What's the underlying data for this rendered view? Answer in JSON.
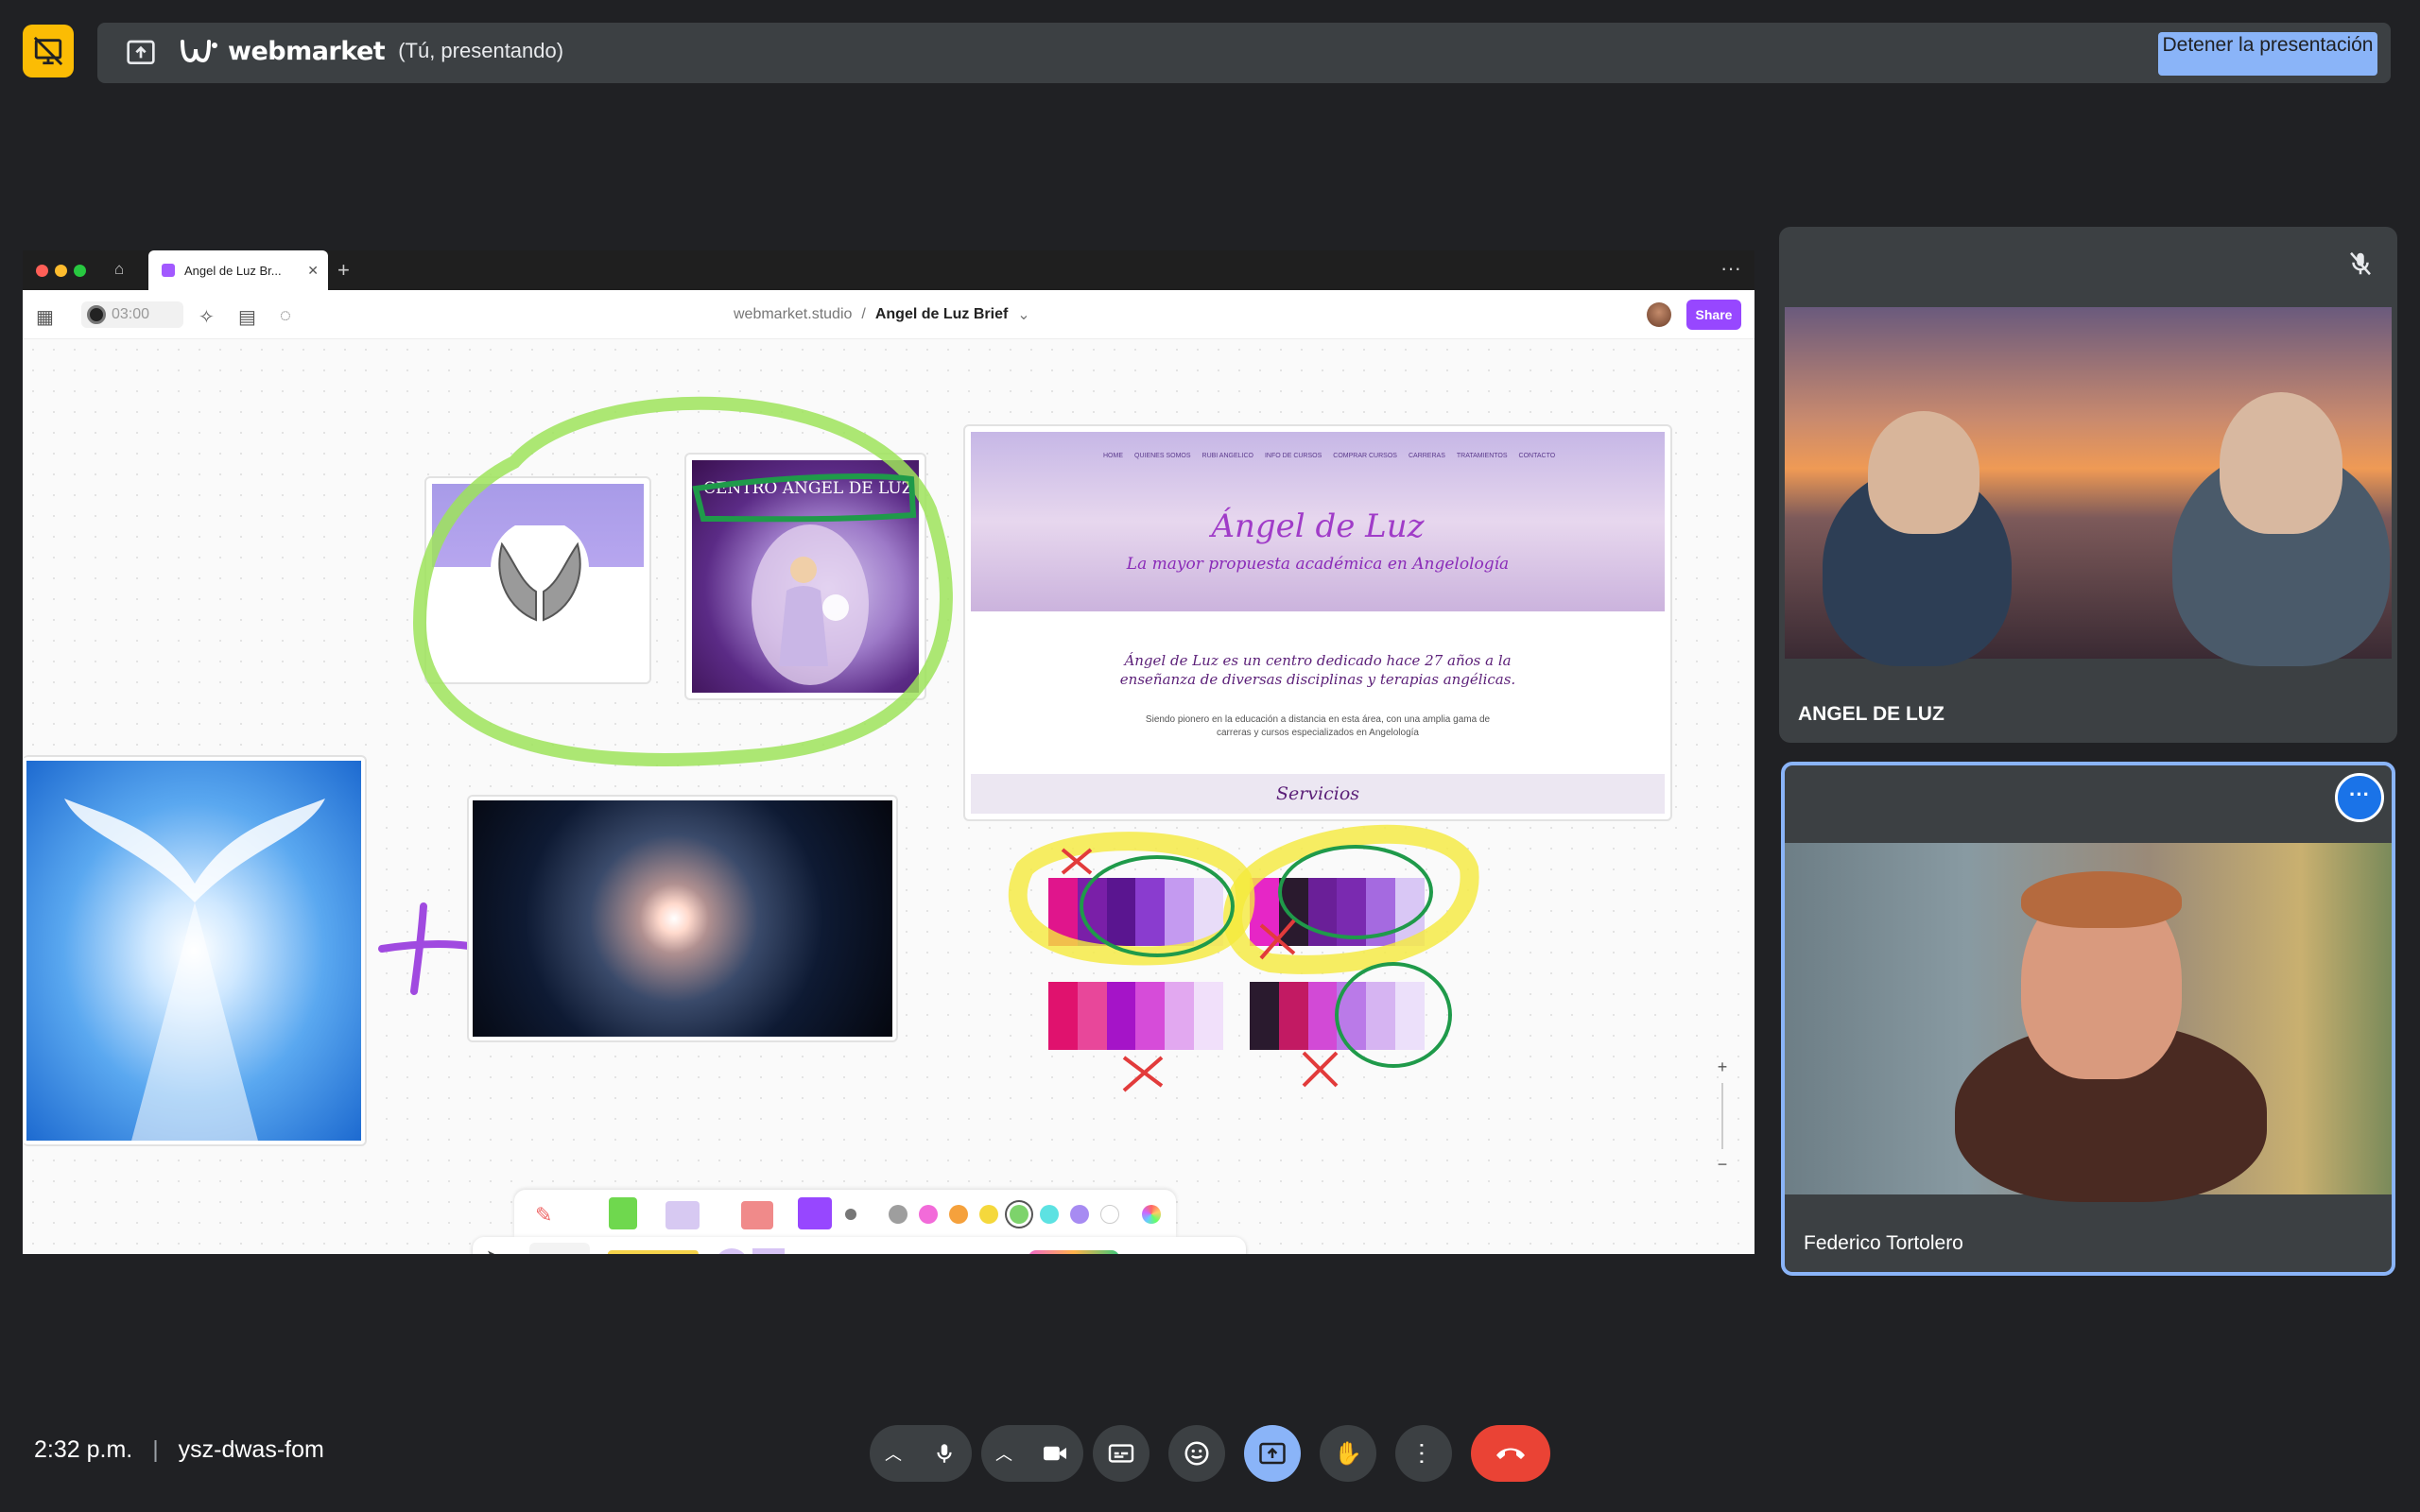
{
  "presenting_bar": {
    "brand": "webmarket",
    "status": "(Tú, presentando)",
    "stop_button": "Detener la presentación",
    "colors": {
      "badge": "#fbbc04",
      "stop_button": "#8ab4f8"
    }
  },
  "shared_screen": {
    "tab_title": "Angel de Luz Br...",
    "timer": "03:00",
    "breadcrumb": {
      "workspace": "webmarket.studio",
      "file": "Angel de Luz Brief"
    },
    "share_button": "Share",
    "cards": {
      "angel_title": "CENTRO ÁNGEL DE LUZ",
      "web": {
        "nav": [
          "HOME",
          "QUIENES SOMOS",
          "RUBI ANGELICO",
          "INFO DE CURSOS",
          "COMPRAR CURSOS",
          "CARRERAS",
          "TRATAMIENTOS",
          "CONTACTO"
        ],
        "title": "Ángel de Luz",
        "subtitle": "La mayor propuesta académica en Angelología",
        "body": "Ángel de Luz es un centro dedicado hace 27 años a la enseñanza de diversas disciplinas y terapias angélicas.",
        "body2": "Siendo pionero en la educación a distancia en esta área, con una amplia gama de carreras y cursos especializados en Angelología",
        "section": "Servicios"
      }
    },
    "palettes": [
      [
        "#e0158c",
        "#7a1fa8",
        "#5a1590",
        "#8a3ccf",
        "#c49af0",
        "#e8dcf8"
      ],
      [
        "#e626c6",
        "#2a1a2e",
        "#6a1f98",
        "#7a2ab0",
        "#a56ae0",
        "#d9c7f5"
      ],
      [
        "#e0126e",
        "#e8479a",
        "#a514c8",
        "#d64cd9",
        "#e2a8f0",
        "#f1e0fa"
      ],
      [
        "#2a1a2e",
        "#c21a63",
        "#d24ad6",
        "#ba7ae8",
        "#d6b4f2",
        "#ece0fa"
      ]
    ],
    "toolbar_colors": [
      "#9e9e9e",
      "#f26bd9",
      "#f5a13c",
      "#f5d83c",
      "#7dd36b",
      "#5de2e2",
      "#a78bf2",
      "#ffffff"
    ]
  },
  "participants": [
    {
      "name": "ANGEL DE LUZ",
      "muted": true
    },
    {
      "name": "Federico Tortolero",
      "active": true
    }
  ],
  "meeting": {
    "time": "2:32 p.m.",
    "code": "ysz-dwas-fom",
    "end_color": "#ea4335"
  }
}
